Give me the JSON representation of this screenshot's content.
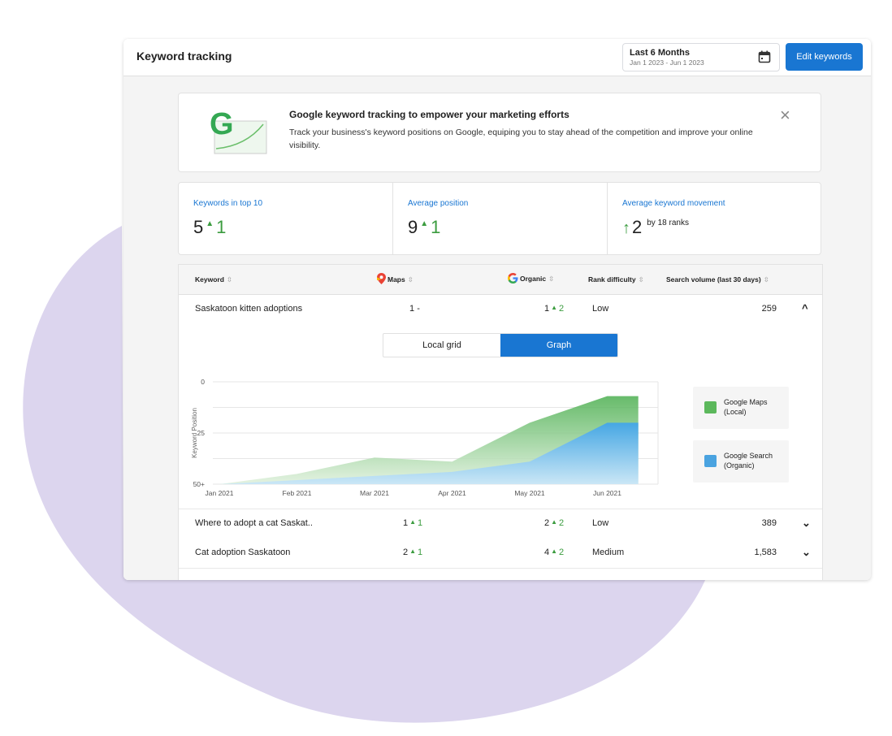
{
  "header": {
    "title": "Keyword tracking",
    "range_label": "Last 6 Months",
    "range_dates": "Jan 1 2023 - Jun 1 2023",
    "edit_label": "Edit keywords"
  },
  "banner": {
    "title": "Google keyword tracking to empower your marketing efforts",
    "body": "Track your business's keyword positions on Google, equiping you to stay ahead of the competition and improve your online visibility.",
    "logo_letter": "G",
    "close_icon": "close-icon"
  },
  "stats": [
    {
      "label": "Keywords in top 10",
      "value": "5",
      "change": "1"
    },
    {
      "label": "Average position",
      "value": "9",
      "change": "1"
    },
    {
      "label": "Average keyword movement",
      "value": "2",
      "suffix": "by 18 ranks"
    }
  ],
  "table": {
    "headers": {
      "keyword": "Keyword",
      "maps": "Maps",
      "organic": "Organic",
      "difficulty": "Rank difficulty",
      "volume": "Search volume (last 30 days)"
    },
    "rows": [
      {
        "keyword": "Saskatoon kitten adoptions",
        "maps": "1",
        "maps_change": "-",
        "organic": "1",
        "organic_change": "2",
        "difficulty": "Low",
        "volume": "259",
        "expanded": true
      },
      {
        "keyword": "Where to adopt a cat Saskat..",
        "maps": "1",
        "maps_change": "1",
        "organic": "2",
        "organic_change": "2",
        "difficulty": "Low",
        "volume": "389"
      },
      {
        "keyword": "Cat adoption Saskatoon",
        "maps": "2",
        "maps_change": "1",
        "organic": "4",
        "organic_change": "2",
        "difficulty": "Medium",
        "volume": "1,583"
      }
    ]
  },
  "detail": {
    "tabs": [
      "Local grid",
      "Graph"
    ],
    "selected_tab": "Graph",
    "legend": [
      {
        "label": "Google Maps (Local)",
        "color": "#5cb85c"
      },
      {
        "label": "Google Search (Organic)",
        "color": "#4aa3e0"
      }
    ]
  },
  "chart_data": {
    "type": "area",
    "x": [
      "Jan 2021",
      "Feb 2021",
      "Mar 2021",
      "Apr 2021",
      "May 2021",
      "Jun 2021"
    ],
    "ylabel": "Keyword Position",
    "yticks": [
      "0",
      "25",
      "50+"
    ],
    "ylim": [
      50,
      0
    ],
    "series": [
      {
        "name": "Google Maps (Local)",
        "points": [
          [
            0,
            50
          ],
          [
            1,
            45
          ],
          [
            2,
            37
          ],
          [
            3,
            39
          ],
          [
            4,
            20
          ],
          [
            5,
            7
          ],
          [
            5.4,
            7
          ]
        ]
      },
      {
        "name": "Google Search (Organic)",
        "points": [
          [
            0,
            50
          ],
          [
            1,
            48
          ],
          [
            2,
            46
          ],
          [
            3,
            44
          ],
          [
            4,
            39
          ],
          [
            5,
            20
          ],
          [
            5.4,
            20
          ]
        ]
      }
    ]
  },
  "colors": {
    "accent": "#1976d2",
    "positive": "#3b9c3f",
    "background_blob": "#dcd5ee"
  }
}
